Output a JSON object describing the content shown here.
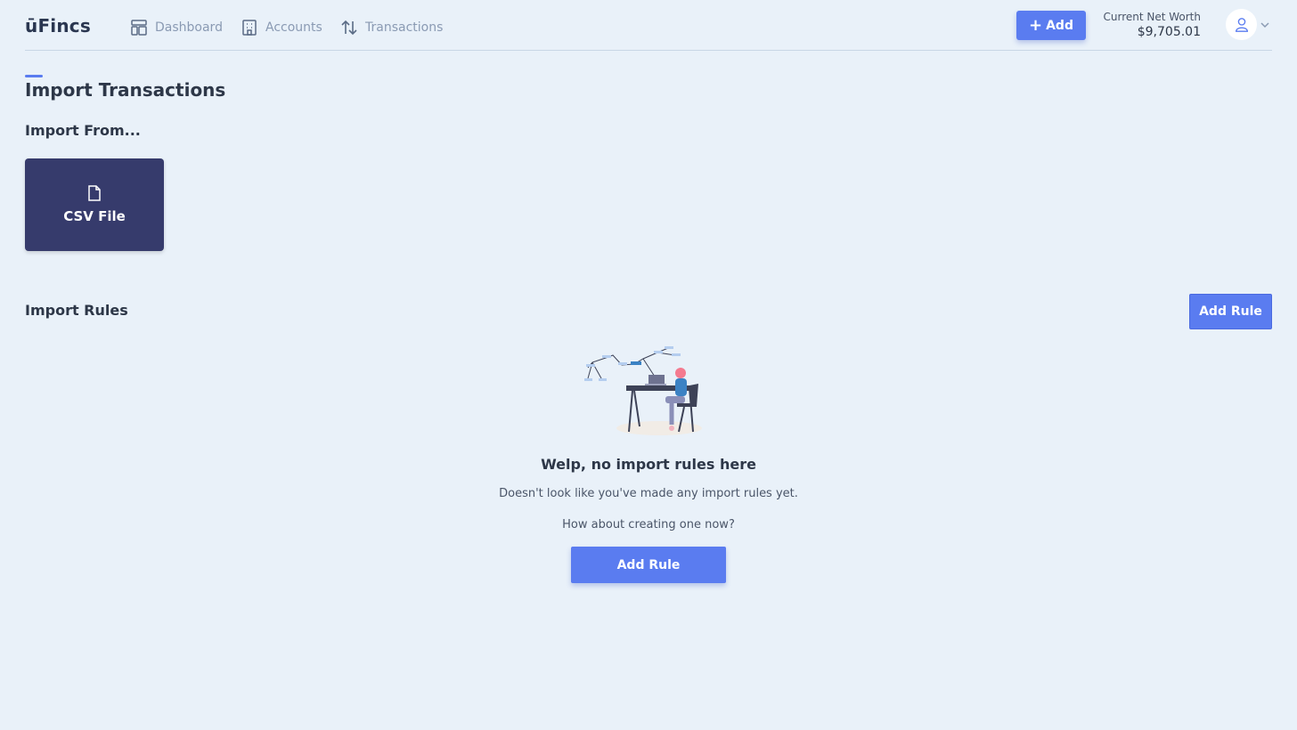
{
  "header": {
    "logo": "ūFincs",
    "nav": [
      {
        "label": "Dashboard",
        "icon": "dashboard-icon"
      },
      {
        "label": "Accounts",
        "icon": "building-icon"
      },
      {
        "label": "Transactions",
        "icon": "arrows-updown-icon"
      }
    ],
    "add_label": "Add",
    "net_worth_label": "Current Net Worth",
    "net_worth_value": "$9,705.01"
  },
  "page": {
    "title": "Import Transactions",
    "import_from_title": "Import From...",
    "csv_label": "CSV File",
    "import_rules_title": "Import Rules",
    "add_rule_label": "Add Rule"
  },
  "empty_state": {
    "title": "Welp, no import rules here",
    "line1": "Doesn't look like you've made any import rules yet.",
    "line2": "How about creating one now?",
    "button": "Add Rule"
  },
  "colors": {
    "background": "#e9f1f9",
    "accent": "#5a7cf0",
    "card": "#363b6c"
  }
}
